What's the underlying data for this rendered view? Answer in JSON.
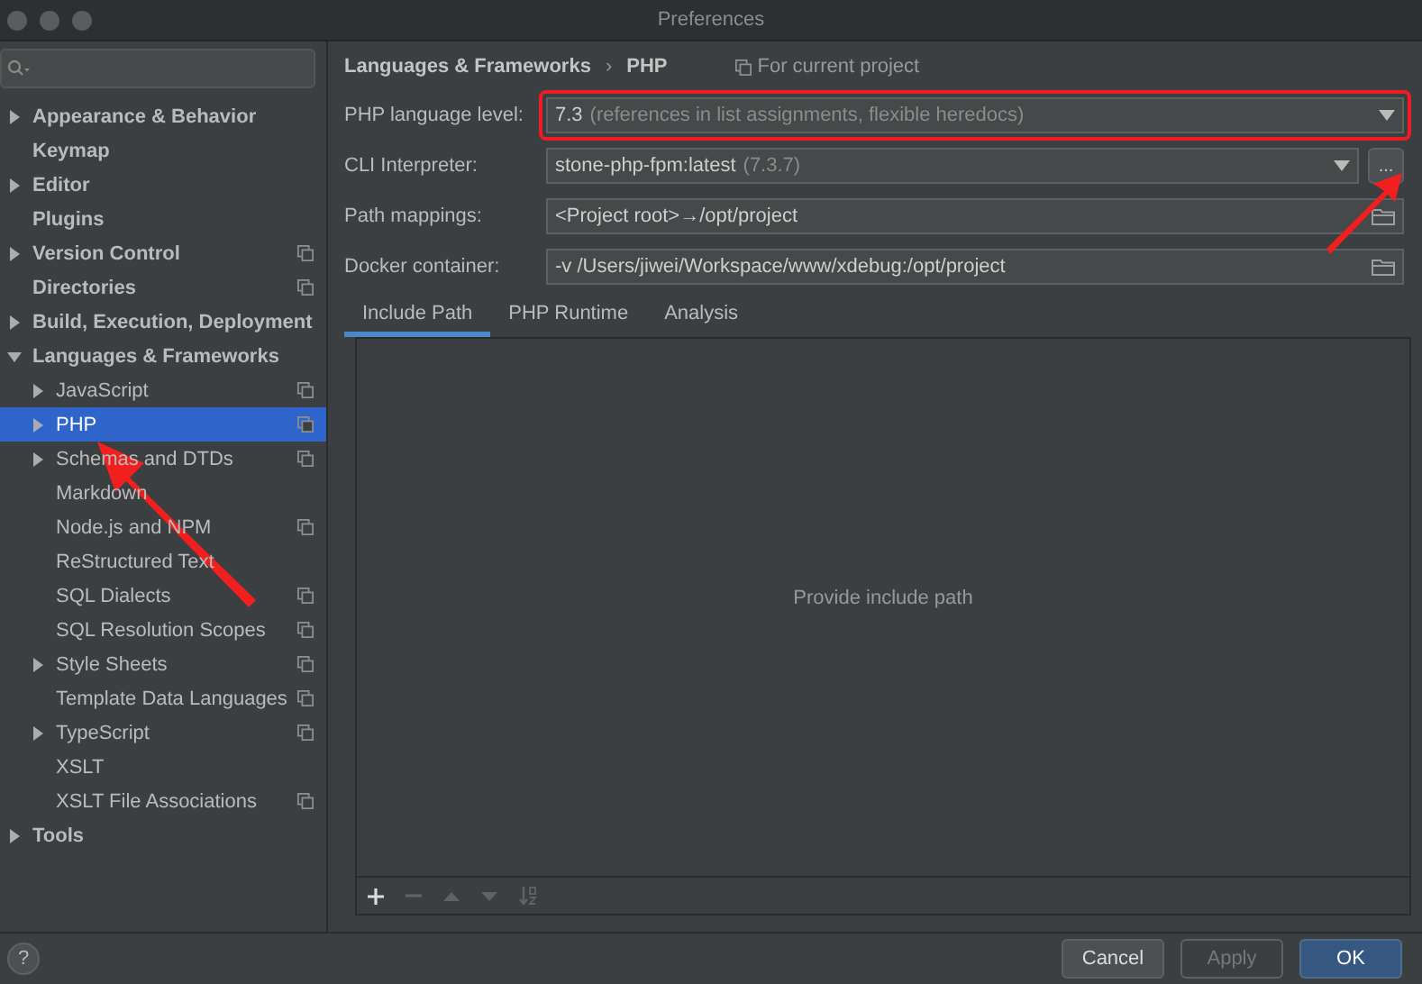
{
  "window": {
    "title": "Preferences"
  },
  "sidebar": {
    "items": [
      {
        "label": "Appearance & Behavior",
        "expandable": true,
        "expanded": false,
        "selected": false,
        "project": false
      },
      {
        "label": "Keymap",
        "expandable": false,
        "selected": false,
        "project": false
      },
      {
        "label": "Editor",
        "expandable": true,
        "expanded": false,
        "selected": false,
        "project": false
      },
      {
        "label": "Plugins",
        "expandable": false,
        "selected": false,
        "project": false
      },
      {
        "label": "Version Control",
        "expandable": true,
        "expanded": false,
        "selected": false,
        "project": true
      },
      {
        "label": "Directories",
        "expandable": false,
        "selected": false,
        "project": true
      },
      {
        "label": "Build, Execution, Deployment",
        "expandable": true,
        "expanded": false,
        "selected": false,
        "project": false
      },
      {
        "label": "Languages & Frameworks",
        "expandable": true,
        "expanded": true,
        "selected": false,
        "project": false,
        "children": [
          {
            "label": "JavaScript",
            "expandable": true,
            "expanded": false,
            "selected": false,
            "project": true
          },
          {
            "label": "PHP",
            "expandable": true,
            "expanded": false,
            "selected": true,
            "project": true
          },
          {
            "label": "Schemas and DTDs",
            "expandable": true,
            "expanded": false,
            "selected": false,
            "project": true
          },
          {
            "label": "Markdown",
            "expandable": false,
            "selected": false,
            "project": false
          },
          {
            "label": "Node.js and NPM",
            "expandable": false,
            "selected": false,
            "project": true
          },
          {
            "label": "ReStructured Text",
            "expandable": false,
            "selected": false,
            "project": false
          },
          {
            "label": "SQL Dialects",
            "expandable": false,
            "selected": false,
            "project": true
          },
          {
            "label": "SQL Resolution Scopes",
            "expandable": false,
            "selected": false,
            "project": true
          },
          {
            "label": "Style Sheets",
            "expandable": true,
            "expanded": false,
            "selected": false,
            "project": true
          },
          {
            "label": "Template Data Languages",
            "expandable": false,
            "selected": false,
            "project": true
          },
          {
            "label": "TypeScript",
            "expandable": true,
            "expanded": false,
            "selected": false,
            "project": true
          },
          {
            "label": "XSLT",
            "expandable": false,
            "selected": false,
            "project": false
          },
          {
            "label": "XSLT File Associations",
            "expandable": false,
            "selected": false,
            "project": true
          }
        ]
      },
      {
        "label": "Tools",
        "expandable": true,
        "expanded": false,
        "selected": false,
        "project": false
      }
    ]
  },
  "breadcrumb": [
    "Languages & Frameworks",
    "PHP"
  ],
  "breadcrumb_separator": "›",
  "help": "?",
  "scope_note": "For current project",
  "form": [
    {
      "label": "PHP language level:",
      "kind": "dropdown",
      "value": "7.3",
      "hint": "(references in list assignments, flexible heredocs)",
      "highlighted": true
    },
    {
      "label": "CLI Interpreter:",
      "kind": "dropdown-more",
      "value": "stone-php-fpm:latest",
      "hint": "(7.3.7)",
      "more": "...",
      "highlighted": false
    },
    {
      "label": "Path mappings:",
      "kind": "browse",
      "value": "<Project root>→/opt/project",
      "highlighted": false
    },
    {
      "label": "Docker container:",
      "kind": "browse",
      "value": "-v /Users/jiwei/Workspace/www/xdebug:/opt/project",
      "highlighted": false
    }
  ],
  "tabs": [
    {
      "label": "Include Path",
      "selected": true
    },
    {
      "label": "PHP Runtime",
      "selected": false
    },
    {
      "label": "Analysis",
      "selected": false
    }
  ],
  "empty_text": "Provide include path",
  "toolbar": [
    {
      "kind": "add",
      "disabled": false
    },
    {
      "kind": "remove",
      "disabled": true
    },
    {
      "kind": "up",
      "disabled": true
    },
    {
      "kind": "down",
      "disabled": true
    },
    {
      "kind": "sort",
      "disabled": true
    }
  ],
  "buttons": [
    {
      "label": "Cancel",
      "kind": "normal",
      "disabled": false
    },
    {
      "label": "Apply",
      "kind": "normal",
      "disabled": true
    },
    {
      "label": "OK",
      "kind": "default",
      "disabled": false
    }
  ]
}
